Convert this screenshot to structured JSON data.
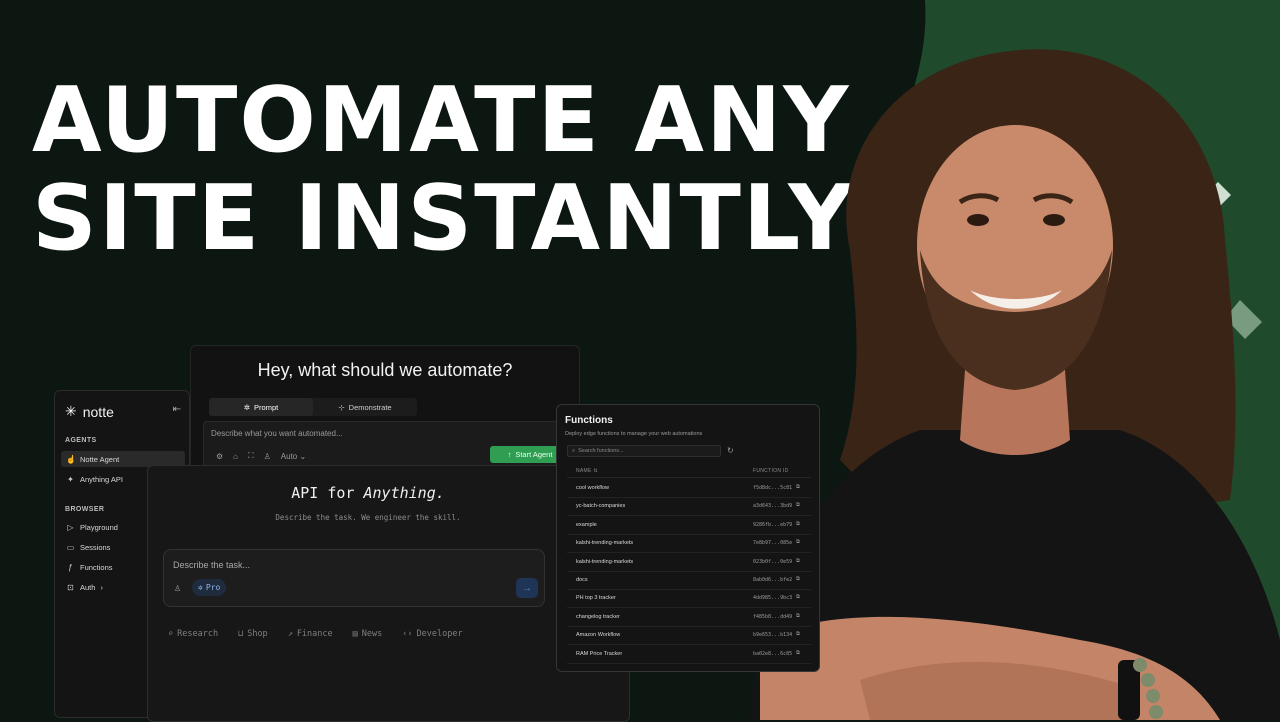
{
  "headline": {
    "line1": "AUTOMATE ANY",
    "line2": "SITE INSTANTLY"
  },
  "colors": {
    "background": "#0d1711",
    "accent_green": "#1f4a2b",
    "start_button": "#2f9d52"
  },
  "sidebar": {
    "brand": "notte",
    "sections": [
      {
        "title": "AGENTS",
        "items": [
          {
            "label": "Notte Agent",
            "icon": "hand-icon",
            "active": true
          },
          {
            "label": "Anything API",
            "icon": "sparkle-icon",
            "active": false
          }
        ]
      },
      {
        "title": "BROWSER",
        "items": [
          {
            "label": "Playground",
            "icon": "play-icon",
            "active": false
          },
          {
            "label": "Sessions",
            "icon": "monitor-icon",
            "active": false
          },
          {
            "label": "Functions",
            "icon": "function-icon",
            "active": false
          },
          {
            "label": "Auth",
            "icon": "auth-icon",
            "active": false
          }
        ]
      }
    ]
  },
  "prompt_window": {
    "question": "Hey, what should we automate?",
    "tabs": [
      {
        "label": "Prompt",
        "active": true
      },
      {
        "label": "Demonstrate",
        "active": false
      }
    ],
    "placeholder": "Describe what you want automated...",
    "mode": "Auto",
    "start_button": "Start Agent"
  },
  "api_window": {
    "title_prefix": "API for ",
    "title_emph": "Anything.",
    "subtitle": "Describe the task. We engineer the skill.",
    "placeholder": "Describe the task...",
    "plan_badge": "Pro",
    "categories": [
      "Research",
      "Shop",
      "Finance",
      "News",
      "Developer"
    ]
  },
  "functions_panel": {
    "title": "Functions",
    "description": "Deploy edge functions to manage your web automations",
    "search_placeholder": "Search functions...",
    "columns": {
      "name": "NAME",
      "id": "FUNCTION ID"
    },
    "rows": [
      {
        "name": "cool workflow",
        "id": "f5d8dc...5c81"
      },
      {
        "name": "yc-batch-companies",
        "id": "a3d643...3bd9"
      },
      {
        "name": "example",
        "id": "9286fb...eb79"
      },
      {
        "name": "kalshi-trending-markets",
        "id": "7e8b97...085e"
      },
      {
        "name": "kalshi-trending-markets",
        "id": "023b0f...0e59"
      },
      {
        "name": "docs",
        "id": "8ab0d6...bfe2"
      },
      {
        "name": "PH top 3 tracker",
        "id": "4dd985...9bc3"
      },
      {
        "name": "changelog tracker",
        "id": "f485b8...dd49"
      },
      {
        "name": "Amazon Workflow",
        "id": "b9e653...b134"
      },
      {
        "name": "RAM Price Tracker",
        "id": "ba02e8...6c85"
      }
    ]
  }
}
